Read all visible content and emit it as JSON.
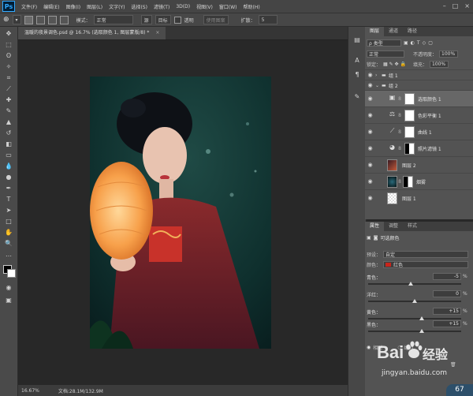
{
  "app": {
    "logo": "Ps"
  },
  "menu": {
    "items": [
      "文件(F)",
      "编辑(E)",
      "图像(I)",
      "图层(L)",
      "文字(Y)",
      "选择(S)",
      "滤镜(T)",
      "3D(D)",
      "视图(V)",
      "窗口(W)",
      "帮助(H)"
    ]
  },
  "window_controls": {
    "minimize": "–",
    "maximize": "□",
    "close": "×"
  },
  "options_bar": {
    "mode_label": "模式：",
    "mode_value": "正常",
    "source_label": "源",
    "target_label": "目标",
    "transparent_label": "透明",
    "use_pattern_label": "使用图案",
    "diffusion_label": "扩散：",
    "diffusion_value": "5"
  },
  "document": {
    "tab_title": "温暖的夜景调色.psd @ 16.7% (选取颜色 1, 图层蒙版/8) *",
    "tab_close": "×"
  },
  "status_bar": {
    "zoom": "16.67%",
    "doc_info": "文档:28.1M/132.9M"
  },
  "layers_panel": {
    "tabs": [
      "图层",
      "通道",
      "路径"
    ],
    "filter_label": "ρ 类型",
    "blend_mode": "正常",
    "opacity_label": "不透明度：",
    "opacity_value": "100%",
    "lock_label": "锁定：",
    "fill_label": "填充：",
    "fill_value": "100%",
    "layers": [
      {
        "name": "组 1",
        "kind": "group",
        "selected": false
      },
      {
        "name": "组 2",
        "kind": "group",
        "selected": false
      },
      {
        "name": "选取颜色 1",
        "kind": "adjustment",
        "icon": "selective-color",
        "selected": true
      },
      {
        "name": "色彩平衡 1",
        "kind": "adjustment",
        "icon": "color-balance",
        "selected": false
      },
      {
        "name": "曲线 1",
        "kind": "adjustment",
        "icon": "curves",
        "selected": false
      },
      {
        "name": "照片滤镜 1",
        "kind": "adjustment",
        "icon": "photo-filter",
        "selected": false
      },
      {
        "name": "图层 2",
        "kind": "pixel",
        "selected": false
      },
      {
        "name": "烟雾",
        "kind": "pixel",
        "selected": false
      },
      {
        "name": "图层 1",
        "kind": "pixel",
        "selected": false
      }
    ]
  },
  "properties_panel": {
    "tabs": [
      "属性",
      "调整",
      "样式"
    ],
    "title": "可选颜色",
    "preset_label": "预设：",
    "preset_value": "自定",
    "colors_label": "颜色：",
    "colors_value": "红色",
    "colors_swatch": "#c8241b",
    "sliders": [
      {
        "label": "青色：",
        "value": "-5",
        "pct": "%",
        "position": 0.46
      },
      {
        "label": "洋红：",
        "value": "0",
        "pct": "%",
        "position": 0.5
      },
      {
        "label": "黄色：",
        "value": "+15",
        "pct": "%",
        "position": 0.575
      },
      {
        "label": "黑色：",
        "value": "+15",
        "pct": "%",
        "position": 0.575
      }
    ],
    "method_relative": "相对",
    "method_absolute": "绝对"
  },
  "badge": {
    "value": "67"
  },
  "watermark": {
    "brand": "Bai",
    "brand_suffix": "经验",
    "url": "jingyan.baidu.com"
  },
  "colors": {
    "accent_ps": "#31a8ff",
    "selected_layer": "#676767",
    "panel": "#535353"
  }
}
